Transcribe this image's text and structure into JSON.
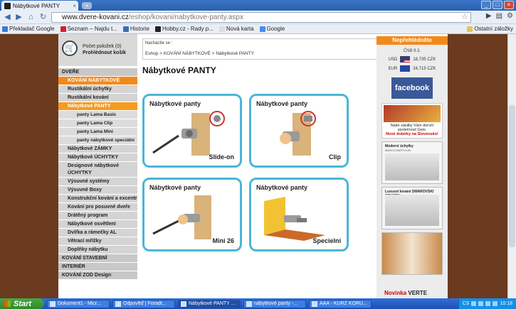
{
  "browser": {
    "tab_title": "Nábytkové PANTY",
    "tab_close": "×",
    "new_tab": "+",
    "url_host": "www.dvere-kovani.cz",
    "url_path": "/eshop/kovani/nabytkove-panty.aspx",
    "win_min": "_",
    "win_max": "□",
    "win_close": "×",
    "bookmarks": [
      {
        "label": "Překladač Google",
        "color": "#3b7bd8"
      },
      {
        "label": "Seznam – Najdu t...",
        "color": "#d32222"
      },
      {
        "label": "Historie",
        "color": "#3a6fb0"
      },
      {
        "label": "Hobby.cz - Rady p...",
        "color": "#222222"
      },
      {
        "label": "Nová karta",
        "color": "#dddddd"
      },
      {
        "label": "Google",
        "color": "#4b8bf5"
      }
    ],
    "other_bookmarks": "Ostatní záložky"
  },
  "cart": {
    "count_label": "Počet položek (0)",
    "view_label": "Prohlédnout košík"
  },
  "menu": [
    {
      "label": "DVEŘE",
      "kind": "top"
    },
    {
      "label": "KOVÁNÍ NÁBYTKOVÉ",
      "kind": "active"
    },
    {
      "label": "Rustikální úchytky",
      "kind": "item"
    },
    {
      "label": "Rustikální kování",
      "kind": "item"
    },
    {
      "label": "Nábytkové PANTY",
      "kind": "sel"
    },
    {
      "label": "panty Lama Basic",
      "kind": "sub"
    },
    {
      "label": "panty Lama Clip",
      "kind": "sub"
    },
    {
      "label": "panty Lama Mini",
      "kind": "sub"
    },
    {
      "label": "panty nábytkové speciální",
      "kind": "sub"
    },
    {
      "label": "Nábytkové ZÁMKY",
      "kind": "item"
    },
    {
      "label": "Nábytkové ÚCHYTKY",
      "kind": "item"
    },
    {
      "label": "Designové nábytkové ÚCHYTKY",
      "kind": "tall"
    },
    {
      "label": "Výsuvné systémy",
      "kind": "item"
    },
    {
      "label": "Výsuvné Boxy",
      "kind": "item"
    },
    {
      "label": "Konstrukční kování a excentry",
      "kind": "item"
    },
    {
      "label": "Kování pro posuvné dveře",
      "kind": "item"
    },
    {
      "label": "Drátěný program",
      "kind": "item"
    },
    {
      "label": "Nábytkové osvětlení",
      "kind": "item"
    },
    {
      "label": "Dvířka a rámečky AL",
      "kind": "item"
    },
    {
      "label": "Větrací mřížky",
      "kind": "item"
    },
    {
      "label": "Doplňky nábytku",
      "kind": "item"
    },
    {
      "label": "KOVÁNÍ STAVEBNÍ",
      "kind": "top"
    },
    {
      "label": "INTERIÉR",
      "kind": "top"
    },
    {
      "label": "KOVÁNÍ ZOD Design",
      "kind": "top"
    }
  ],
  "content": {
    "location_label": "Nacházíte se :",
    "breadcrumb": "Eshop > KOVÁNÍ NÁBYTKOVÉ > Nábytkové PANTY",
    "heading": "Nábytkové PANTY",
    "cards": [
      {
        "title": "Nábytkové panty",
        "subtitle": "Slide-on"
      },
      {
        "title": "Nábytkové panty",
        "subtitle": "Clip"
      },
      {
        "title": "Nábytkové panty",
        "subtitle": "Mini 26"
      },
      {
        "title": "Nábytkové panty",
        "subtitle": "Specielní"
      }
    ]
  },
  "sidebar": {
    "header": "Nepřehlédněte",
    "cnb_label": "ČNB 9.3.",
    "usd_label": "USD",
    "usd_value": "18,735 CZK",
    "eur_label": "EUR",
    "eur_value": "24,715 CZK",
    "facebook": "facebook",
    "promo_text": "Naše zásilky Vám doručí společnost Geis.",
    "promo_red": "Nové dobírky na Slovensko!",
    "ad1_title": "Moderní úchytky",
    "ad1_sub": "MARCO BARTOLIN",
    "ad2_title": "Luxusní kování SWAROVSKI CRYSTAL",
    "novinka": "Novinka",
    "novinka_word": "VERTE"
  },
  "taskbar": {
    "start": "Start",
    "tasks": [
      "Dokument1 - Micr...",
      "Odpověď | Foradt...",
      "Nábytkové PANTY ...",
      "nábytkové panty -...",
      "AAA - KURZ KORU..."
    ],
    "lang": "CS",
    "clock": "10:18"
  }
}
